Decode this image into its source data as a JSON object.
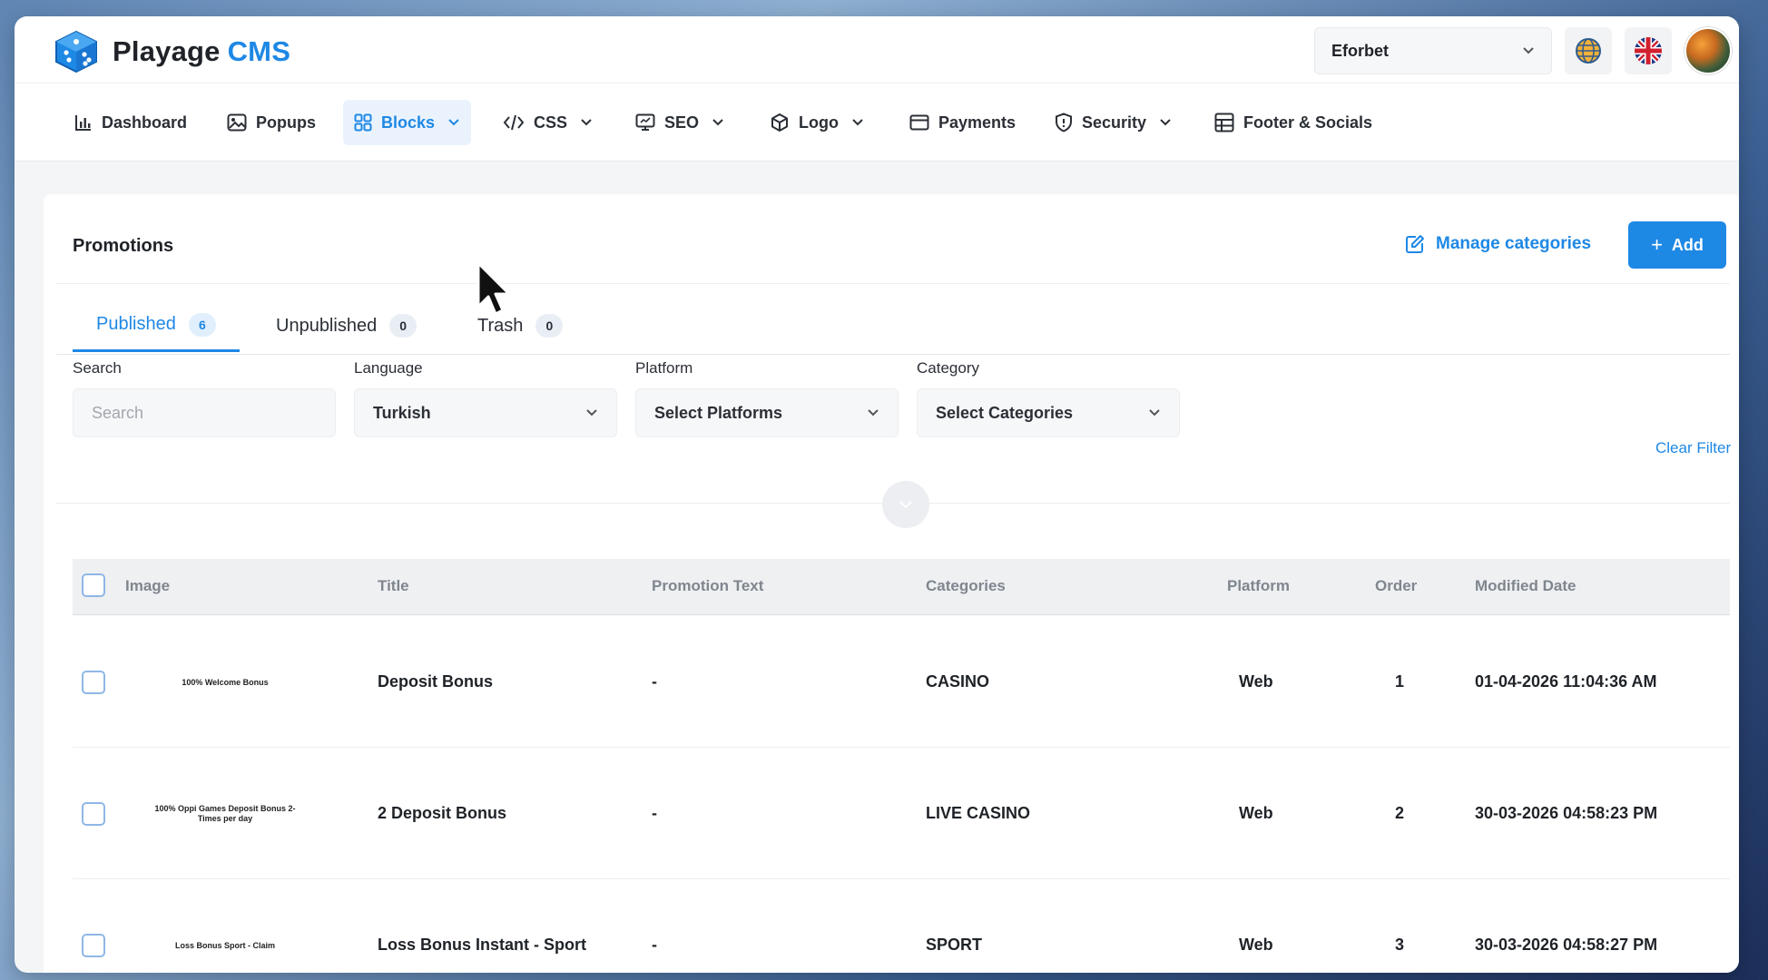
{
  "header": {
    "brand": "Playage",
    "product": "CMS",
    "site_selected": "Eforbet"
  },
  "nav": {
    "items": [
      {
        "label": "Dashboard"
      },
      {
        "label": "Popups"
      },
      {
        "label": "Blocks"
      },
      {
        "label": "CSS"
      },
      {
        "label": "SEO"
      },
      {
        "label": "Logo"
      },
      {
        "label": "Payments"
      },
      {
        "label": "Security"
      },
      {
        "label": "Footer & Socials"
      }
    ]
  },
  "page": {
    "title": "Promotions",
    "manage_categories": "Manage categories",
    "add_label": "Add"
  },
  "tabs": [
    {
      "label": "Published",
      "count": "6"
    },
    {
      "label": "Unpublished",
      "count": "0"
    },
    {
      "label": "Trash",
      "count": "0"
    }
  ],
  "filters": {
    "search_label": "Search",
    "search_placeholder": "Search",
    "language_label": "Language",
    "language_value": "Turkish",
    "platform_label": "Platform",
    "platform_value": "Select Platforms",
    "category_label": "Category",
    "category_value": "Select Categories",
    "clear": "Clear Filter"
  },
  "table": {
    "columns": [
      "Image",
      "Title",
      "Promotion Text",
      "Categories",
      "Platform",
      "Order",
      "Modified Date"
    ],
    "rows": [
      {
        "image_text": "100% Welcome Bonus",
        "title": "Deposit Bonus",
        "promo_text": "-",
        "category": "CASINO",
        "platform": "Web",
        "order": "1",
        "modified": "01-04-2026 11:04:36 AM"
      },
      {
        "image_text": "100% Oppi Games Deposit Bonus 2-Times per day",
        "title": "2 Deposit Bonus",
        "promo_text": "-",
        "category": "LIVE CASINO",
        "platform": "Web",
        "order": "2",
        "modified": "30-03-2026 04:58:23 PM"
      },
      {
        "image_text": "Loss Bonus Sport - Claim",
        "title": "Loss Bonus Instant - Sport",
        "promo_text": "-",
        "category": "SPORT",
        "platform": "Web",
        "order": "3",
        "modified": "30-03-2026 04:58:27 PM"
      }
    ]
  }
}
